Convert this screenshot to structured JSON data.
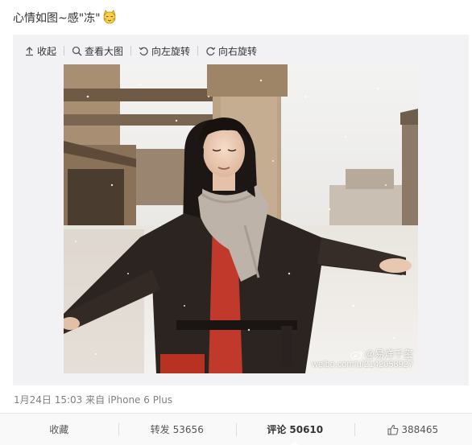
{
  "post": {
    "text": "心情如图~感\"冻\"",
    "emoji": "cat-face-emoji",
    "meta": "1月24日 15:03 来自 iPhone 6 Plus"
  },
  "toolbar": {
    "collapse_label": "收起",
    "view_large_label": "查看大图",
    "rotate_left_label": "向左旋转",
    "rotate_right_label": "向右旋转"
  },
  "photo": {
    "subject": "person in snow with arms outstretched",
    "watermark_user": "@易烊千玺",
    "watermark_url": "weibo.com/u/2142058927"
  },
  "actions": {
    "favorite_label": "收藏",
    "repost_label": "转发",
    "repost_count": "53656",
    "comment_label": "评论",
    "comment_count": "50610",
    "like_count": "388465"
  },
  "colors": {
    "accent_orange": "#eb7350",
    "text_gray": "#808080",
    "media_bg": "#f2f2f5"
  }
}
